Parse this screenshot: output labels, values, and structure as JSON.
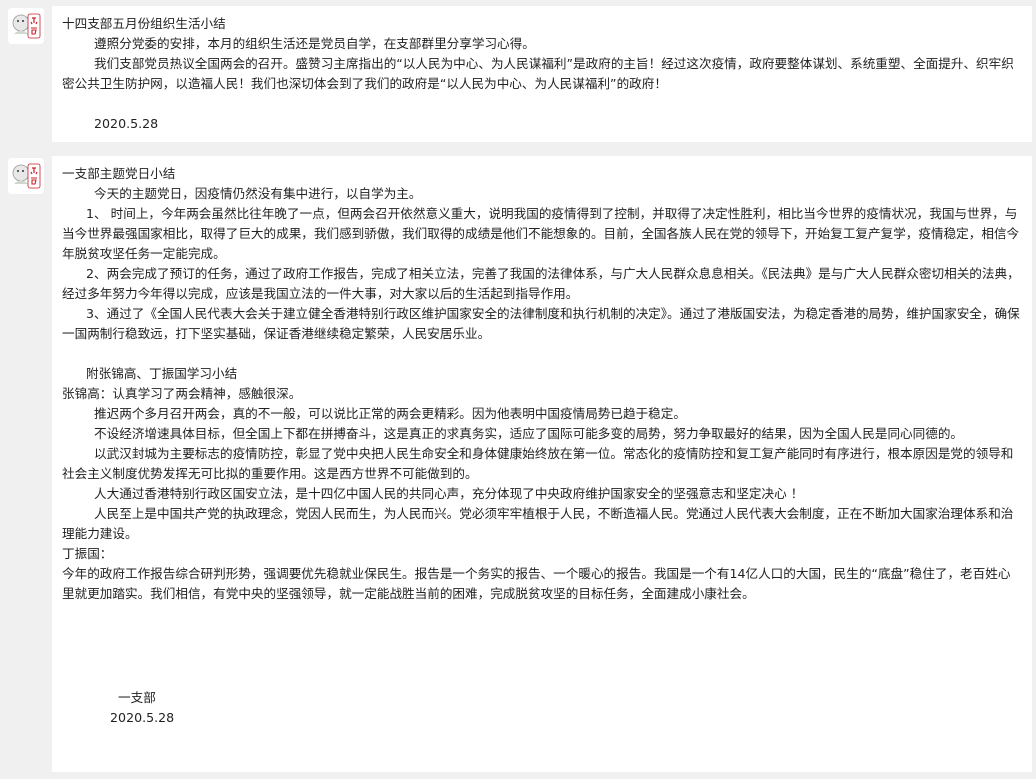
{
  "post1": {
    "avatar_icon": "logo-avatar-icon",
    "lines": [
      "十四支部五月份组织生活小结",
      "        遵照分党委的安排，本月的组织生活还是党员自学，在支部群里分享学习心得。",
      "        我们支部党员热议全国两会的召开。盛赞习主席指出的“以人民为中心、为人民谋福利”是政府的主旨！经过这次疫情，政府要整体谋划、系统重塑、全面提升、织牢织密公共卫生防护网，以造福人民！我们也深切体会到了我们的政府是“以人民为中心、为人民谋福利”的政府！"
    ],
    "date": "        2020.5.28"
  },
  "post2": {
    "avatar_icon": "logo-avatar-icon",
    "lines_a": [
      "一支部主题党日小结",
      "        今天的主题党日，因疫情仍然没有集中进行，以自学为主。",
      "      1、 时间上，今年两会虽然比往年晚了一点，但两会召开依然意义重大，说明我国的疫情得到了控制，并取得了决定性胜利，相比当今世界的疫情状况，我国与世界，与当今世界最强国家相比，取得了巨大的成果，我们感到骄傲，我们取得的成绩是他们不能想象的。目前，全国各族人民在党的领导下，开始复工复产复学，疫情稳定，相信今年脱贫攻坚任务一定能完成。",
      "      2、两会完成了预订的任务，通过了政府工作报告，完成了相关立法，完善了我国的法律体系，与广大人民群众息息相关。《民法典》是与广大人民群众密切相关的法典，经过多年努力今年得以完成，应该是我国立法的一件大事，对大家以后的生活起到指导作用。",
      "      3、通过了《全国人民代表大会关于建立健全香港特别行政区维护国家安全的法律制度和执行机制的决定》。通过了港版国安法，为稳定香港的局势，维护国家安全，确保一国两制行稳致远，打下坚实基础，保证香港继续稳定繁荣，人民安居乐业。"
    ],
    "lines_b": [
      "      附张锦高、丁振国学习小结",
      "张锦高：认真学习了两会精神，感触很深。",
      "        推迟两个多月召开两会，真的不一般，可以说比正常的两会更精彩。因为他表明中国疫情局势已趋于稳定。",
      "        不设经济增速具体目标，但全国上下都在拼搏奋斗，这是真正的求真务实，适应了国际可能多变的局势，努力争取最好的结果，因为全国人民是同心同德的。",
      "        以武汉封城为主要标志的疫情防控，彰显了党中央把人民生命安全和身体健康始终放在第一位。常态化的疫情防控和复工复产能同时有序进行，根本原因是党的领导和社会主义制度优势发挥无可比拟的重要作用。这是西方世界不可能做到的。",
      "        人大通过香港特别行政区国安立法，是十四亿中国人民的共同心声，充分体现了中央政府维护国家安全的坚强意志和坚定决心 ！",
      "        人民至上是中国共产党的执政理念，党因人民而生，为人民而兴。党必须牢牢植根于人民，不断造福人民。党通过人民代表大会制度，正在不断加大国家治理体系和治理能力建设。",
      "丁振国：",
      "今年的政府工作报告综合研判形势，强调要优先稳就业保民生。报告是一个务实的报告、一个暖心的报告。我国是一个有14亿人口的大国，民生的“底盘”稳住了，老百姓心里就更加踏实。我们相信，有党中央的坚强领导，就一定能战胜当前的困难，完成脱贫攻坚的目标任务，全面建成小康社会。"
    ],
    "signature": "              一支部",
    "date": "            2020.5.28"
  }
}
